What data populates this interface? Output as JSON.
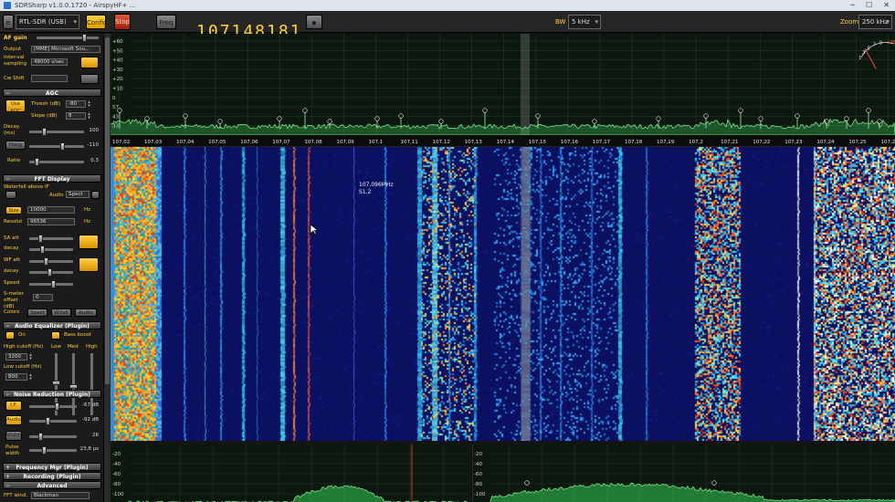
{
  "window": {
    "title": "SDRSharp v1.0.0.1720 - AirspyHF+ ..."
  },
  "toolbar": {
    "device": "RTL-SDR (USB)",
    "config_label": "Config",
    "stop_label": "Stop",
    "freq_label": "Freq",
    "frequency": "107148181",
    "bw_label": "BW",
    "bw_value": "5 kHz",
    "zoom_label": "Zoom",
    "zoom_value": "250 kHz"
  },
  "left_panel": {
    "af_gain_label": "AF gain",
    "output_label": "Output",
    "output_value": "[MME] Microsoft Sou...",
    "sample_rate_label": "Inter-val sampling",
    "sample_rate_value": "48000 s/sec",
    "cw_shift_label": "Cw Shift",
    "agc_title": "AGC",
    "agc_use_label": "Use AGC",
    "threshold_label": "Thresh (dB)",
    "threshold_value": "-80",
    "slope_label": "Slope (dB)",
    "slope_value": "8",
    "decay_label": "Decay (ms)",
    "decay_value": "100",
    "hang_label": "Hang",
    "hang_value": "-110",
    "ratio_label": "Ratio",
    "ratio_value": "0,3",
    "fft_title": "FFT Display",
    "waterfall_label": "Waterfall above IF",
    "audio_label": "Audio",
    "spectrum_label": "Spect",
    "fft_size_label": "Size",
    "fft_size_value": "10000",
    "hz_unit": "Hz",
    "resolution_label": "Resolut",
    "resolution_value": "96536",
    "sa_att_label": "SA att",
    "decay_fft_label": "decay",
    "wf_att_label": "WF att",
    "speed_label": "Speed",
    "smeter_offset_label": "S-meter offset (dB)",
    "smeter_offset_value": "0",
    "colors_label": "Colors",
    "spect_btn": "Spect",
    "wfall_btn": "W.fall",
    "audio_btn": "Audio",
    "audio_eq_title": "Audio Equalizer (Plugin)",
    "eq_on_label": "On",
    "bass_boost_label": "Bass boost",
    "high_cutoff_label": "High cutoff (Hz)",
    "high_cutoff_value": "3200",
    "low_cutoff_label": "Low cutoff (Hz)",
    "low_cutoff_value": "800",
    "low_label": "Low",
    "med_label": "Med",
    "high_label": "High",
    "noise_title": "Noise Reduction (Plugin)",
    "nr_if_label": "I.F.",
    "nr_if_value": "-67 dB",
    "nr_audio_label": "Audio",
    "nr_audio_value": "-92 dB",
    "nr_width_label": "Width",
    "nr_width_value": "26",
    "nr_pulse_label": "Pulse width",
    "nr_pulse_value": "23,8 µs",
    "freq_mgr_title": "Frequency Mgr (Plugin)",
    "recording_title": "Recording (Plugin)",
    "advanced_title": "Advanced",
    "fft_window_label": "FFT wind.",
    "fft_window_value": "Blackman"
  },
  "spectrum": {
    "db_ticks": [
      "+60",
      "+50",
      "+40",
      "+30",
      "+20",
      "+10",
      "0",
      "57",
      "43",
      "33"
    ],
    "freq_ticks": [
      "107,02",
      "107,03",
      "107,04",
      "107,05",
      "107,06",
      "107,07",
      "107,08",
      "107,09",
      "107,1",
      "107,11",
      "107,12",
      "107,13",
      "107,14",
      "107,15",
      "107,16",
      "107,17",
      "107,18",
      "107,19",
      "107,2",
      "107,21",
      "107,22",
      "107,23",
      "107,24",
      "107,25",
      "107,26"
    ],
    "smeter_ticks": [
      "1",
      "3",
      "5",
      "7",
      "9",
      "+20"
    ]
  },
  "waterfall": {
    "cursor_freq": "107,096MHz",
    "cursor_signal": "S1,2"
  },
  "bottom_left": {
    "db_ticks": [
      "-20",
      "-40",
      "-60",
      "-80",
      "-100"
    ]
  },
  "bottom_right": {
    "db_ticks": [
      "-20",
      "-40",
      "-60",
      "-80",
      "-100"
    ]
  }
}
